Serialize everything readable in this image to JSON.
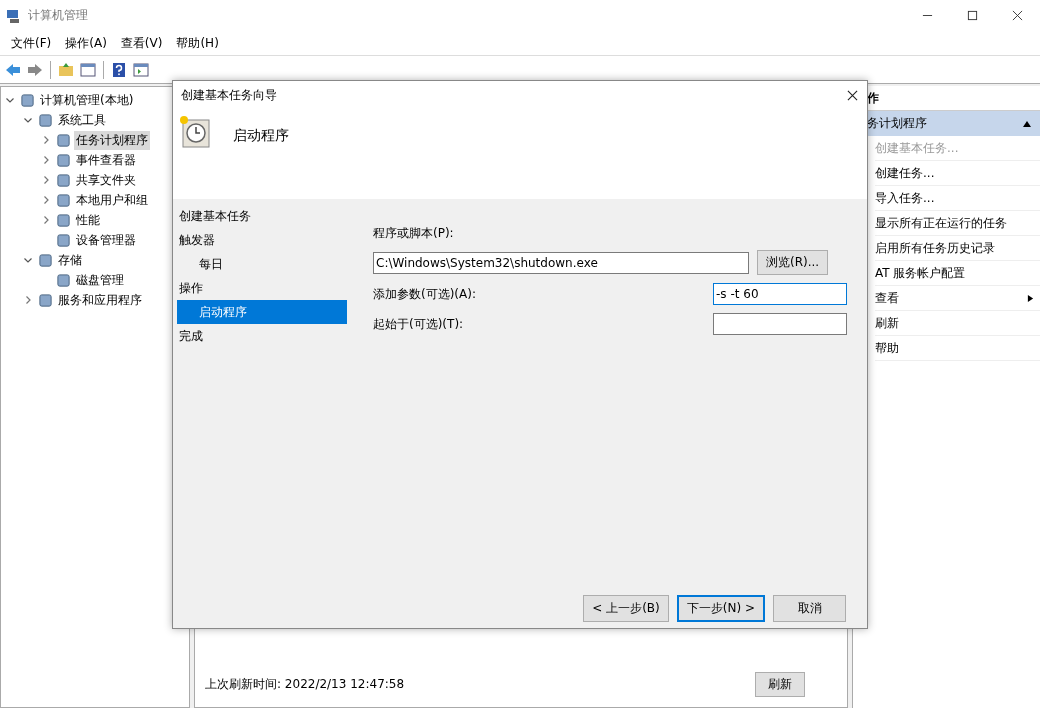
{
  "window": {
    "title": "计算机管理"
  },
  "menu": [
    "文件(F)",
    "操作(A)",
    "查看(V)",
    "帮助(H)"
  ],
  "tree": [
    {
      "label": "计算机管理(本地)",
      "expanded": true,
      "selected": false,
      "children": [
        {
          "label": "系统工具",
          "expanded": true,
          "selected": false,
          "children": [
            {
              "label": "任务计划程序",
              "expanded": false,
              "selected": true
            },
            {
              "label": "事件查看器",
              "expanded": false,
              "selected": false
            },
            {
              "label": "共享文件夹",
              "expanded": false,
              "selected": false
            },
            {
              "label": "本地用户和组",
              "expanded": false,
              "selected": false
            },
            {
              "label": "性能",
              "expanded": false,
              "selected": false
            },
            {
              "label": "设备管理器",
              "selected": false
            }
          ]
        },
        {
          "label": "存储",
          "expanded": true,
          "selected": false,
          "children": [
            {
              "label": "磁盘管理",
              "selected": false
            }
          ]
        },
        {
          "label": "服务和应用程序",
          "expanded": false,
          "selected": false
        }
      ]
    }
  ],
  "center": {
    "last_refresh": "上次刷新时间: 2022/2/13 12:47:58",
    "refresh_button": "刷新"
  },
  "actions": {
    "header": "作",
    "section": {
      "label": "务计划程序",
      "expanded": true
    },
    "items": [
      {
        "label": "创建基本任务...",
        "disabled": true,
        "kind": "action"
      },
      {
        "label": "创建任务...",
        "disabled": false,
        "kind": "action"
      },
      {
        "label": "导入任务...",
        "disabled": false,
        "kind": "action"
      },
      {
        "label": "显示所有正在运行的任务",
        "disabled": false,
        "kind": "action"
      },
      {
        "label": "启用所有任务历史记录",
        "disabled": false,
        "kind": "action"
      },
      {
        "label": "AT 服务帐户配置",
        "disabled": false,
        "kind": "action"
      },
      {
        "label": "查看",
        "disabled": false,
        "kind": "submenu"
      },
      {
        "label": "刷新",
        "disabled": false,
        "kind": "action"
      },
      {
        "label": "帮助",
        "disabled": false,
        "kind": "action"
      }
    ]
  },
  "dialog": {
    "title": "创建基本任务向导",
    "heading": "启动程序",
    "steps": [
      {
        "label": "创建基本任务",
        "selected": false
      },
      {
        "label": "触发器",
        "selected": false,
        "children": [
          {
            "label": "每日",
            "selected": false
          }
        ]
      },
      {
        "label": "操作",
        "selected": false,
        "children": [
          {
            "label": "启动程序",
            "selected": true
          }
        ]
      },
      {
        "label": "完成",
        "selected": false
      }
    ],
    "program": {
      "label": "程序或脚本(P):",
      "value": "C:\\Windows\\System32\\shutdown.exe",
      "browse": "浏览(R)..."
    },
    "arguments": {
      "label": "添加参数(可选)(A):",
      "value": "-s -t 60"
    },
    "start_in": {
      "label": "起始于(可选)(T):"
    },
    "buttons": [
      {
        "label": "< 上一步(B)",
        "default": false
      },
      {
        "label": "下一步(N) >",
        "default": true
      },
      {
        "label": "取消",
        "default": false
      }
    ]
  }
}
